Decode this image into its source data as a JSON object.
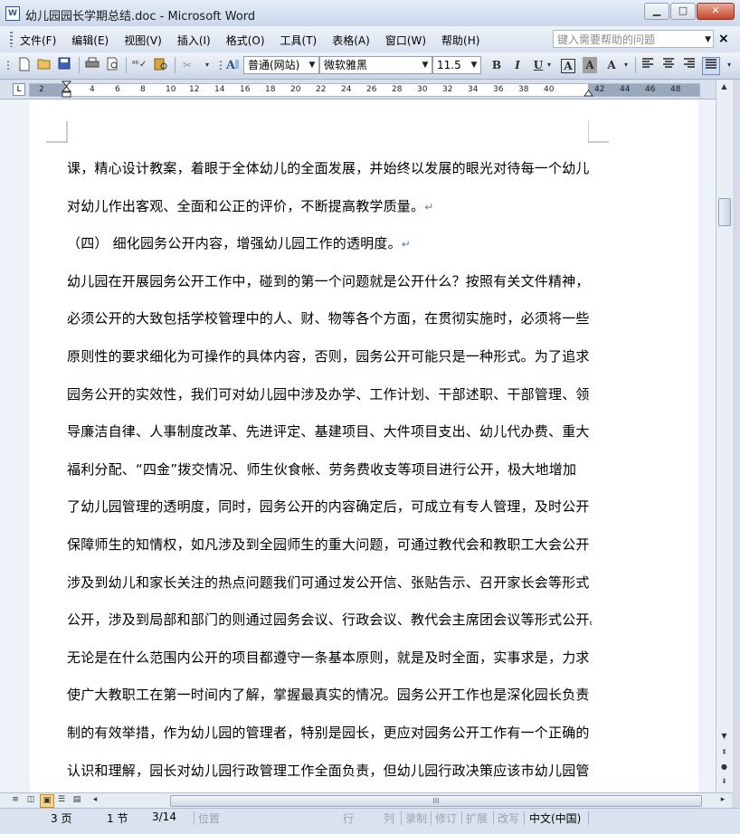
{
  "window": {
    "title": "幼儿园园长学期总结.doc - Microsoft Word",
    "app_icon": "W"
  },
  "window_controls": {
    "minimize": "▁",
    "maximize": "□",
    "close": "✕"
  },
  "menubar": {
    "items": [
      "文件(F)",
      "编辑(E)",
      "视图(V)",
      "插入(I)",
      "格式(O)",
      "工具(T)",
      "表格(A)",
      "窗口(W)",
      "帮助(H)"
    ],
    "help_placeholder": "键入需要帮助的问题",
    "close_label": "×"
  },
  "toolbar": {
    "style_value": "普通(网站)",
    "font_value": "微软雅黑",
    "size_value": "11.5",
    "bold": "B",
    "italic": "I",
    "underline": "U",
    "char_border": "A",
    "char_shading": "A",
    "highlight": "A",
    "icons": [
      "new-document-icon",
      "open-icon",
      "save-icon",
      "print-icon",
      "print-preview-icon",
      "spelling-icon",
      "research-icon",
      "cut-icon",
      "styles-icon",
      "align-left-icon",
      "center-icon",
      "align-right-icon",
      "justify-icon"
    ]
  },
  "ruler": {
    "tab_selector": "L",
    "left_ticks": [
      "2",
      "2",
      "4",
      "6",
      "8",
      "10",
      "12",
      "14",
      "16",
      "18",
      "20",
      "22",
      "24",
      "26",
      "28",
      "30",
      "32",
      "34",
      "36",
      "38",
      "40"
    ],
    "right_ticks": [
      "42",
      "44",
      "46",
      "48"
    ]
  },
  "document": {
    "paragraphs": [
      {
        "text": "课，精心设计教案，着眼于全体幼儿的全面发展，并始终以发展的眼光对待每一个幼儿，",
        "mark": ""
      },
      {
        "text": "对幼儿作出客观、全面和公正的评价，不断提高教学质量。",
        "mark": "↵"
      },
      {
        "text": "（四） 细化园务公开内容，增强幼儿园工作的透明度。",
        "mark": "↵"
      },
      {
        "text": "幼儿园在开展园务公开工作中，碰到的第一个问题就是公开什么？按照有关文件精神，",
        "mark": ""
      },
      {
        "text": "必须公开的大致包括学校管理中的人、财、物等各个方面，在贯彻实施时，必须将一些",
        "mark": ""
      },
      {
        "text": "原则性的要求细化为可操作的具体内容，否则，园务公开可能只是一种形式。为了追求",
        "mark": ""
      },
      {
        "text": "园务公开的实效性，我们可对幼儿园中涉及办学、工作计划、干部述职、干部管理、领",
        "mark": ""
      },
      {
        "text": "导廉洁自律、人事制度改革、先进评定、基建项目、大件项目支出、幼儿代办费、重大",
        "mark": ""
      },
      {
        "text": "福利分配、“四金”拨交情况、师生伙食帐、劳务费收支等项目进行公开，极大地增加",
        "mark": ""
      },
      {
        "text": "了幼儿园管理的透明度，同时，园务公开的内容确定后，可成立有专人管理，及时公开，",
        "mark": ""
      },
      {
        "text": "保障师生的知情权，如凡涉及到全园师生的重大问题，可通过教代会和教职工大会公开，",
        "mark": ""
      },
      {
        "text": "涉及到幼儿和家长关注的热点问题我们可通过发公开信、张贴告示、召开家长会等形式",
        "mark": ""
      },
      {
        "text": "公开，涉及到局部和部门的则通过园务会议、行政会议、教代会主席团会议等形式公开。",
        "mark": ""
      },
      {
        "text": "无论是在什么范围内公开的项目都遵守一条基本原则，就是及时全面，实事求是，力求",
        "mark": ""
      },
      {
        "text": "使广大教职工在第一时间内了解，掌握最真实的情况。园务公开工作也是深化园长负责",
        "mark": ""
      },
      {
        "text": "制的有效举措，作为幼儿园的管理者，特别是园长，更应对园务公开工作有一个正确的",
        "mark": ""
      },
      {
        "text": "认识和理解，园长对幼儿园行政管理工作全面负责，但幼儿园行政决策应该市幼儿园管",
        "mark": ""
      }
    ]
  },
  "vscroll": {
    "up": "▲",
    "down": "▼",
    "prev_page": "⇞",
    "browse": "●",
    "next_page": "⇟"
  },
  "hscroll": {
    "left": "◂",
    "right": "▸",
    "grip": "III"
  },
  "statusbar": {
    "page": "3 页",
    "section": "1 节",
    "page_of": "3/14",
    "position": "位置",
    "line": "行",
    "column": "列",
    "rec": "录制",
    "trk": "修订",
    "ext": "扩展",
    "ovr": "改写",
    "language": "中文(中国)"
  }
}
